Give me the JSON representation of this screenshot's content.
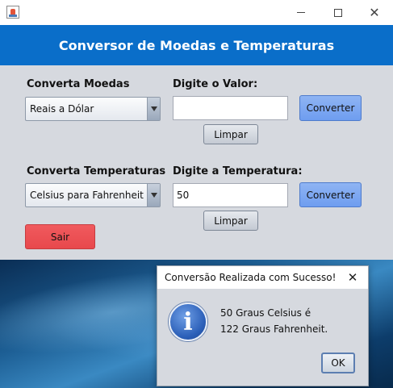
{
  "header": {
    "title": "Conversor de Moedas e Temperaturas"
  },
  "currency": {
    "label": "Converta Moedas",
    "selected": "Reais a Dólar",
    "value_label": "Digite o Valor:",
    "value": "",
    "convert_label": "Converter",
    "clear_label": "Limpar"
  },
  "temperature": {
    "label": "Converta Temperaturas",
    "selected": "Celsius para Fahrenheit",
    "value_label": "Digite a Temperatura:",
    "value": "50",
    "convert_label": "Converter",
    "clear_label": "Limpar"
  },
  "exit_label": "Sair",
  "dialog": {
    "title": "Conversão Realizada com Sucesso!",
    "line1": "50 Graus Celsius é",
    "line2": "122 Graus Fahrenheit.",
    "ok_label": "OK"
  },
  "colors": {
    "header": "#0a6ec9",
    "convert_button": "#6e9df0",
    "exit_button": "#e8484c",
    "panel": "#d6d9df"
  },
  "icons": {
    "app": "java-cup-icon",
    "dialog": "info-icon"
  }
}
